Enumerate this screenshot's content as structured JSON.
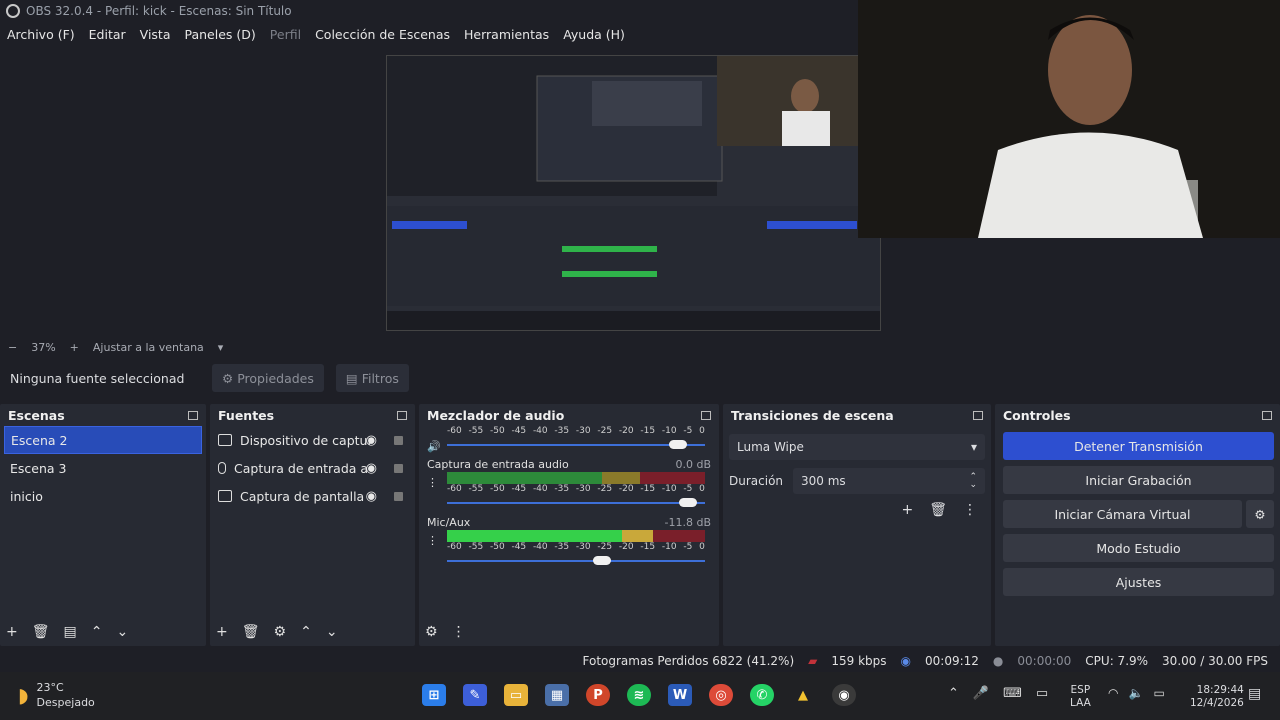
{
  "window": {
    "title": "OBS 32.0.4 - Perfil: kick - Escenas: Sin Título"
  },
  "menu": {
    "items": [
      "Archivo (F)",
      "Editar",
      "Vista",
      "Paneles (D)",
      "Perfil",
      "Colección de Escenas",
      "Herramientas",
      "Ayuda (H)"
    ]
  },
  "zoom": {
    "minus": "−",
    "value": "37%",
    "plus": "+",
    "fit": "Ajustar a la ventana"
  },
  "source_bar": {
    "no_source": "Ninguna fuente seleccionad",
    "properties": "Propiedades",
    "filters": "Filtros"
  },
  "scenes": {
    "title": "Escenas",
    "items": [
      "Escena 2",
      "Escena 3",
      "inicio"
    ],
    "selected": "Escena 2"
  },
  "sources": {
    "title": "Fuentes",
    "items": [
      {
        "name": "Dispositivo de captur",
        "icon": "camera-icon"
      },
      {
        "name": "Captura de entrada a",
        "icon": "mic-icon"
      },
      {
        "name": "Captura de pantalla",
        "icon": "monitor-icon"
      }
    ]
  },
  "mixer": {
    "title": "Mezclador de audio",
    "ticks": [
      "-60",
      "-55",
      "-50",
      "-45",
      "-40",
      "-35",
      "-30",
      "-25",
      "-20",
      "-15",
      "-10",
      "-5",
      "0"
    ],
    "tracks": [
      {
        "name": "",
        "db": "",
        "volume_fraction": 0.93
      },
      {
        "name": "Captura de entrada audio",
        "db": "0.0 dB",
        "level_fraction": 0.0,
        "volume_fraction": 0.97
      },
      {
        "name": "Mic/Aux",
        "db": "-11.8 dB",
        "level_fraction": 0.8,
        "volume_fraction": 0.6
      }
    ]
  },
  "transitions": {
    "title": "Transiciones de escena",
    "selected": "Luma Wipe",
    "duration_label": "Duración",
    "duration_value": "300 ms"
  },
  "controls": {
    "title": "Controles",
    "stop_stream": "Detener Transmisión",
    "start_recording": "Iniciar Grabación",
    "virtual_cam": "Iniciar Cámara Virtual",
    "studio_mode": "Modo Estudio",
    "settings": "Ajustes"
  },
  "status": {
    "dropped_frames": "Fotogramas Perdidos 6822 (41.2%)",
    "bitrate": "159 kbps",
    "stream_time": "00:09:12",
    "rec_time": "00:00:00",
    "cpu": "CPU: 7.9%",
    "fps": "30.00 / 30.00 FPS"
  },
  "taskbar": {
    "weather_temp": "23°C",
    "weather_desc": "Despejado",
    "lang_1": "ESP",
    "lang_2": "LAA",
    "time": "18:29:44",
    "date": "12/4/2026"
  },
  "colors": {
    "accent": "#2d4fd0",
    "selected": "#284cb8",
    "panel": "#272a33",
    "background": "#1e1f26"
  }
}
